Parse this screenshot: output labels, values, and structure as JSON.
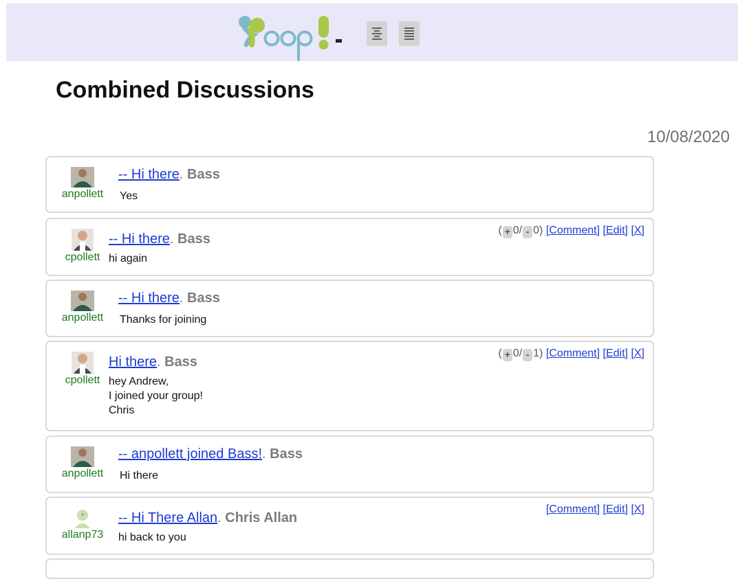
{
  "header": {
    "logo_alt": "Yoopi",
    "view_buttons": [
      "centered-view-icon",
      "list-view-icon"
    ]
  },
  "page": {
    "title": "Combined Discussions",
    "date": "10/08/2020"
  },
  "posts": [
    {
      "user": "anpollett",
      "title": "-- Hi there",
      "group": "Bass",
      "body": [
        "Yes"
      ],
      "actions": null
    },
    {
      "user": "cpollett",
      "title": "-- Hi there",
      "group": "Bass",
      "body": [
        "hi again"
      ],
      "actions": {
        "open": "(",
        "up_symbol": "+",
        "up_count": "0/",
        "down_symbol": "-",
        "down_count": "0)",
        "comment": "[Comment]",
        "edit": "[Edit]",
        "delete": "[X]"
      }
    },
    {
      "user": "anpollett",
      "title": "-- Hi there",
      "group": "Bass",
      "body": [
        "Thanks for joining"
      ],
      "actions": null
    },
    {
      "user": "cpollett",
      "title": "Hi there",
      "group": "Bass",
      "body": [
        "hey Andrew,",
        "I joined your group!",
        "Chris"
      ],
      "actions": {
        "open": "(",
        "up_symbol": "+",
        "up_count": "0/",
        "down_symbol": "-",
        "down_count": "1)",
        "comment": "[Comment]",
        "edit": "[Edit]",
        "delete": "[X]"
      }
    },
    {
      "user": "anpollett",
      "title": "-- anpollett joined Bass!",
      "group": "Bass",
      "body": [
        "Hi there"
      ],
      "actions": null
    },
    {
      "user": "allanp73",
      "title": "-- Hi There Allan",
      "group": "Chris Allan",
      "body": [
        "hi back to you"
      ],
      "actions": {
        "comment": "[Comment]",
        "edit": "[Edit]",
        "delete": "[X]"
      }
    }
  ],
  "colors": {
    "header_bg": "#e9e8f8",
    "link": "#1d3bd6",
    "username": "#1b7a1b",
    "group": "#7b7b7b",
    "border": "#d9d9d9"
  }
}
